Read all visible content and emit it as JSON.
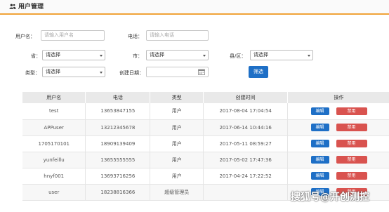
{
  "header": {
    "title": "用户管理",
    "icon": "users-icon"
  },
  "filters": {
    "username": {
      "label": "用户名：",
      "placeholder": "请输入用户名"
    },
    "phone": {
      "label": "电话：",
      "placeholder": "请输入电话"
    },
    "province": {
      "label": "省：",
      "value": "请选择"
    },
    "city": {
      "label": "市：",
      "value": "请选择"
    },
    "county": {
      "label": "县/区：",
      "value": "请选择"
    },
    "type": {
      "label": "类型：",
      "value": "请选择"
    },
    "created_date": {
      "label": "创建日期：",
      "value": ""
    },
    "filter_button": "筛选"
  },
  "table": {
    "columns": [
      "用户名",
      "电话",
      "类型",
      "创建时间",
      "操作"
    ],
    "rows": [
      {
        "username": "test",
        "phone": "13653847155",
        "type": "用户",
        "created": "2017-08-04 17:04:54",
        "edit": "编辑",
        "delete": "禁用"
      },
      {
        "username": "APPuser",
        "phone": "13212345678",
        "type": "用户",
        "created": "2017-06-14 10:44:16",
        "edit": "编辑",
        "delete": "禁用"
      },
      {
        "username": "1705170101",
        "phone": "18909139409",
        "type": "用户",
        "created": "2017-05-11 08:59:27",
        "edit": "编辑",
        "delete": "禁用"
      },
      {
        "username": "yunfeillu",
        "phone": "13655555555",
        "type": "用户",
        "created": "2017-05-02 17:47:36",
        "edit": "编辑",
        "delete": "禁用"
      },
      {
        "username": "hnyf001",
        "phone": "13693716256",
        "type": "用户",
        "created": "2017-04-24 17:22:52",
        "edit": "编辑",
        "delete": "禁用"
      },
      {
        "username": "user",
        "phone": "18238816366",
        "type": "超级管理员",
        "created": "",
        "edit": "编辑",
        "delete": "禁用"
      }
    ]
  },
  "watermark": "搜狐号@开创测控",
  "colors": {
    "accent_line": "#f0a338",
    "primary": "#1e6fc6",
    "danger": "#d9534f"
  }
}
